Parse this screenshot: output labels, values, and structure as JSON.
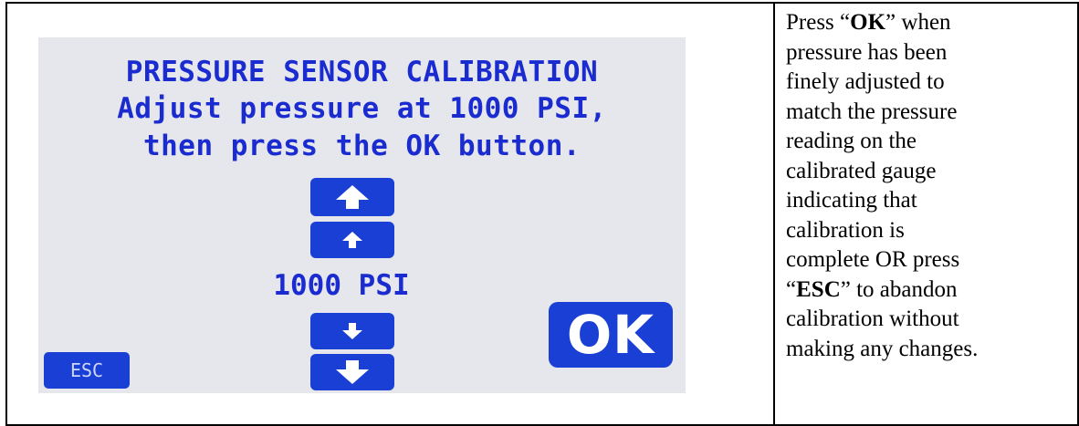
{
  "screen": {
    "title": "PRESSURE SENSOR CALIBRATION",
    "instruction_line1": "Adjust pressure at 1000 PSI,",
    "instruction_line2": "then press the OK button.",
    "pressure_value": "1000 PSI",
    "ok_label": "OK",
    "esc_label": "ESC",
    "colors": {
      "screen_bg": "#e6e7ec",
      "text_blue": "#1a2bd0",
      "button_blue": "#1a3fd4"
    },
    "icons": [
      "arrow-up-large-icon",
      "arrow-up-small-icon",
      "arrow-down-small-icon",
      "arrow-down-large-icon"
    ]
  },
  "instructions": {
    "l1_pre": "Press “",
    "l1_bold": "OK",
    "l1_post": "” when",
    "l2": "pressure has been",
    "l3": "finely adjusted to",
    "l4": "match the pressure",
    "l5": "reading on the",
    "l6": "calibrated gauge",
    "l7": "indicating that",
    "l8": "calibration is",
    "l9": "complete OR press",
    "l10_pre": "“",
    "l10_bold": "ESC",
    "l10_post": "” to abandon",
    "l11": "calibration without",
    "l12": "making any changes."
  }
}
